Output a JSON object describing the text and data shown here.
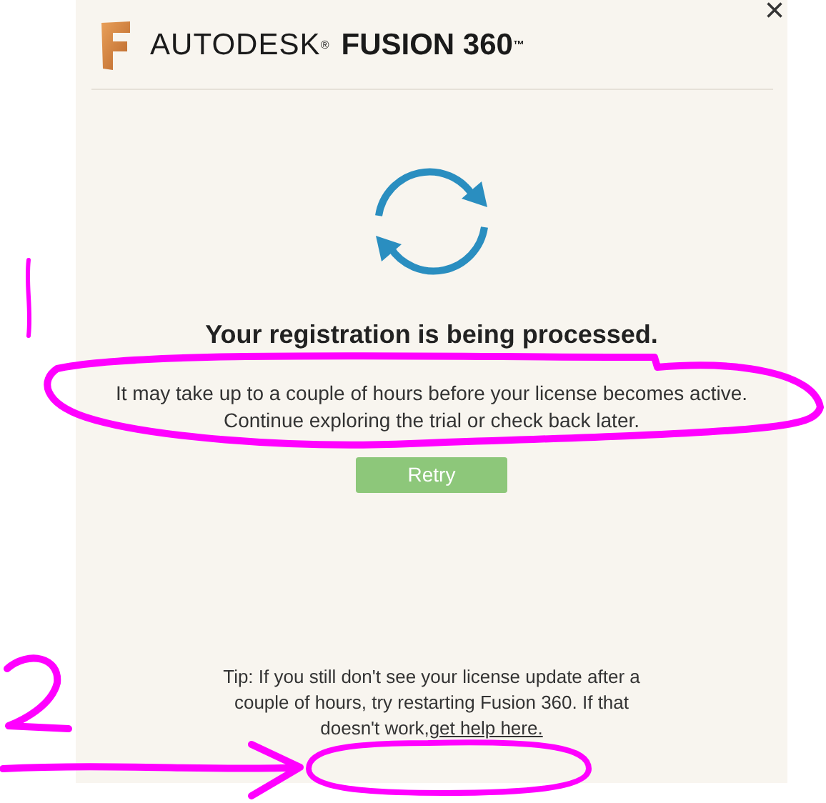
{
  "header": {
    "brand": "AUTODESK$^{®}$",
    "product": "FUSION 360$^{™}$"
  },
  "close": "×",
  "status": {
    "title": "Your registration is being processed.",
    "message": "It may take up to a couple of hours before your license becomes active. Continue exploring the trial or check back later."
  },
  "retry_button": "Retry",
  "tip": {
    "text": "Tip: If you still don't see your license update after a couple of hours, try restarting Fusion 360. If that doesn't work,",
    "link": "get help here."
  }
}
